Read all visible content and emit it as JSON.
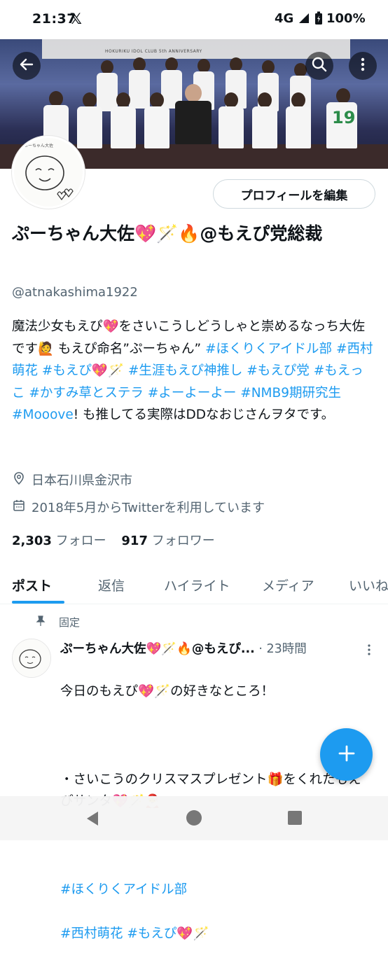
{
  "status_bar": {
    "time": "21:37",
    "network": "4G",
    "battery": "100%"
  },
  "banner": {
    "text": "HOKURIKU IDOL CLUB 5th ANNIVERSARY",
    "shirt_number": "19"
  },
  "header_actions": {
    "back": "back",
    "search": "search",
    "more": "more"
  },
  "avatar": {
    "signature": "ぷーちゃん大佐"
  },
  "edit_profile_label": "プロフィールを編集",
  "profile": {
    "name": "ぷーちゃん大佐💖🪄🔥@もえぴ党総裁",
    "handle": "@atnakashima1922",
    "bio_segments": [
      {
        "text": "魔法少女もえぴ💖をさいこうしどうしゃと崇めるなっち大佐です🙋 もえぴ命名”ぷーちゃん” ",
        "link": false
      },
      {
        "text": "#ほくりくアイドル部",
        "link": true
      },
      {
        "text": " ",
        "link": false
      },
      {
        "text": "#西村萌花",
        "link": true
      },
      {
        "text": " ",
        "link": false
      },
      {
        "text": "#もえぴ",
        "link": true
      },
      {
        "text": "💖🪄 ",
        "link": false
      },
      {
        "text": "#生涯もえぴ神推し",
        "link": true
      },
      {
        "text": " ",
        "link": false
      },
      {
        "text": "#もえぴ党",
        "link": true
      },
      {
        "text": " ",
        "link": false
      },
      {
        "text": "#もえっこ",
        "link": true
      },
      {
        "text": " ",
        "link": false
      },
      {
        "text": "#かすみ草とステラ",
        "link": true
      },
      {
        "text": " ",
        "link": false
      },
      {
        "text": "#よーよーよー",
        "link": true
      },
      {
        "text": " ",
        "link": false
      },
      {
        "text": "#NMB9期研究生",
        "link": true
      },
      {
        "text": " ",
        "link": false
      },
      {
        "text": "#Mooove",
        "link": true
      },
      {
        "text": "! も推してる実際はDDなおじさんヲタです。",
        "link": false
      }
    ],
    "location": "日本石川県金沢市",
    "joined": "2018年5月からTwitterを利用しています",
    "following_count": "2,303",
    "following_label": "フォロー",
    "followers_count": "917",
    "followers_label": "フォロワー"
  },
  "tabs": [
    "ポスト",
    "返信",
    "ハイライト",
    "メディア",
    "いいね"
  ],
  "active_tab": "ポスト",
  "pinned_post": {
    "pinned_label": "固定",
    "author": "ぷーちゃん大佐💖🪄🔥@もえぴ...",
    "time": "23時間",
    "body_lines": [
      "今日のもえぴ💖🪄の好きなところ！",
      "",
      "・さいこうのクリスマスプレゼント🎁をくれたもえぴサンタ💖🪄🎅"
    ],
    "hashtags": [
      "#ほくりくアイドル部",
      "#西村萌花",
      "#もえぴ"
    ],
    "hashtag_suffix": "💖🪄"
  },
  "colors": {
    "accent": "#1d9bf0",
    "text": "#0f1419",
    "secondary": "#536471"
  }
}
